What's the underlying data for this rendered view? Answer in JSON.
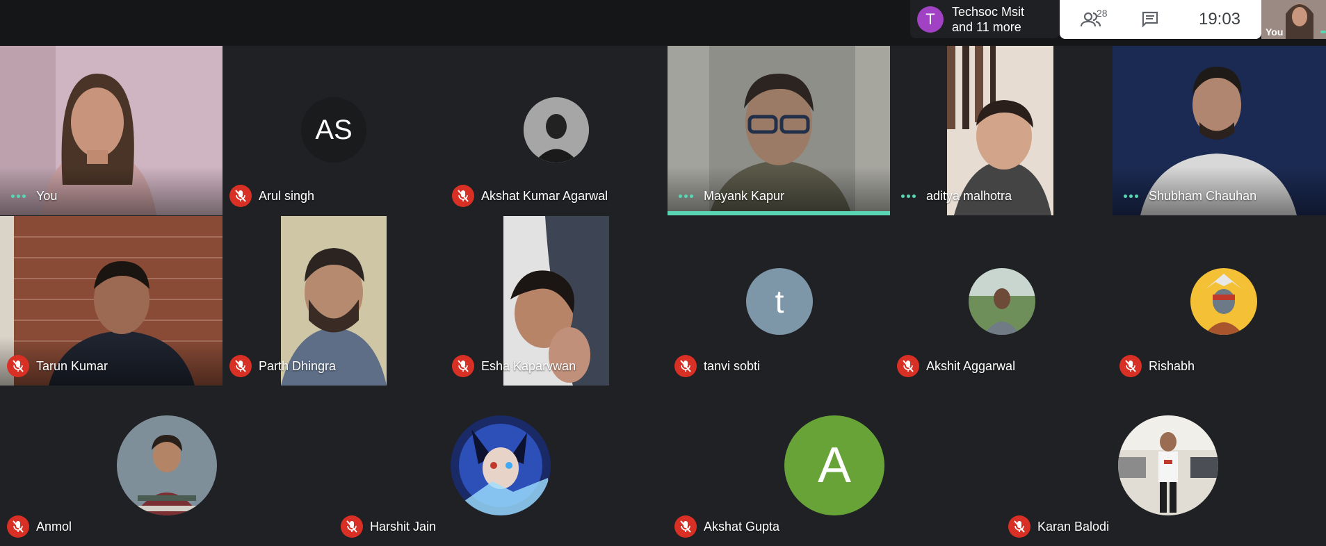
{
  "top": {
    "presenting": {
      "initial": "T",
      "line1": "Techsoc Msit",
      "line2": "and 11 more",
      "color": "#a142c4"
    },
    "participants_count": "28",
    "time": "19:03",
    "self_label": "You"
  },
  "participants": [
    {
      "name": "You",
      "indicator": "speaking-dots"
    },
    {
      "name": "Arul singh",
      "indicator": "muted",
      "initials": "AS"
    },
    {
      "name": "Akshat Kumar Agarwal",
      "indicator": "muted"
    },
    {
      "name": "Mayank Kapur",
      "indicator": "speaking-dots",
      "active_speaker": true
    },
    {
      "name": "aditya malhotra",
      "indicator": "speaking-dots"
    },
    {
      "name": "Shubham Chauhan",
      "indicator": "speaking-dots"
    },
    {
      "name": "Tarun Kumar",
      "indicator": "muted"
    },
    {
      "name": "Parth Dhingra",
      "indicator": "muted"
    },
    {
      "name": "Esha Kaparvwan",
      "indicator": "muted"
    },
    {
      "name": "tanvi sobti",
      "indicator": "muted",
      "initials": "t"
    },
    {
      "name": "Akshit Aggarwal",
      "indicator": "muted"
    },
    {
      "name": "Rishabh",
      "indicator": "muted"
    },
    {
      "name": "Anmol",
      "indicator": "muted"
    },
    {
      "name": "Harshit Jain",
      "indicator": "muted"
    },
    {
      "name": "Akshat Gupta",
      "indicator": "muted",
      "initials": "A"
    },
    {
      "name": "Karan Balodi",
      "indicator": "muted"
    }
  ],
  "colors": {
    "accent": "#5bd6b4",
    "mute": "#d93025",
    "bg": "#202124",
    "tanvi_avatar": "#7e97a8",
    "akshat_gupta_avatar": "#68a338"
  }
}
